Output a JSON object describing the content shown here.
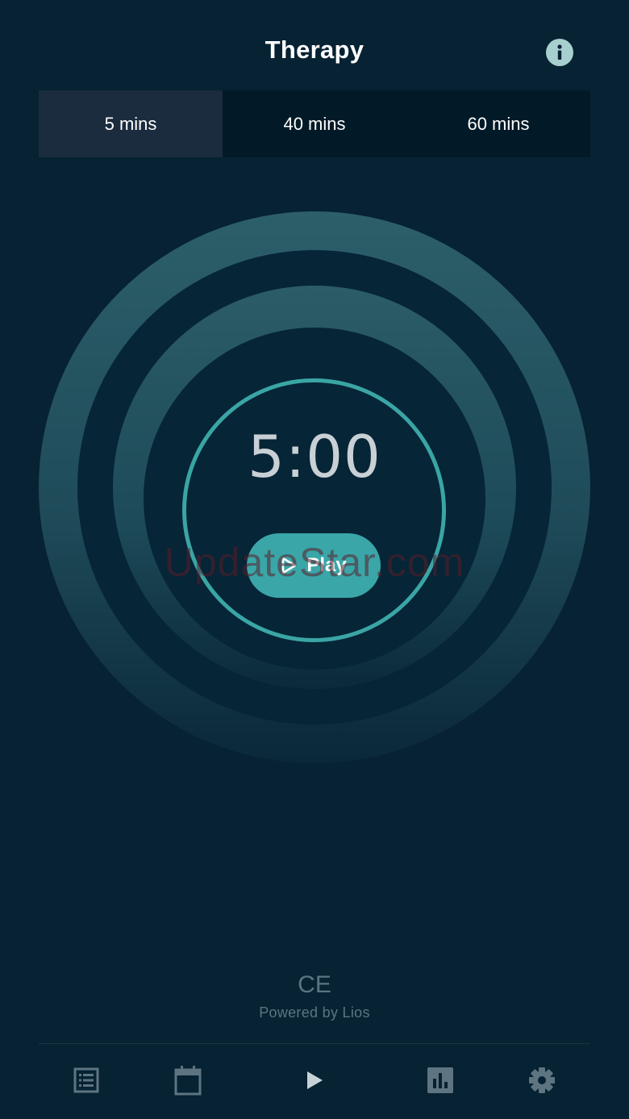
{
  "header": {
    "title": "Therapy",
    "info_icon": "info-icon"
  },
  "durations": {
    "options": [
      {
        "label": "5 mins",
        "active": true
      },
      {
        "label": "40 mins",
        "active": false
      },
      {
        "label": "60 mins",
        "active": false
      }
    ]
  },
  "timer": {
    "display": "5:00",
    "play_label": "Play",
    "play_icon": "play-icon"
  },
  "watermark": "UpdateStar.com",
  "footer": {
    "certification_mark": "CE",
    "powered_by": "Powered by Lios"
  },
  "nav": {
    "items": [
      {
        "name": "list",
        "icon": "list-icon",
        "active": false
      },
      {
        "name": "calendar",
        "icon": "calendar-icon",
        "active": false
      },
      {
        "name": "play",
        "icon": "play-icon",
        "active": true
      },
      {
        "name": "stats",
        "icon": "bar-chart-icon",
        "active": false
      },
      {
        "name": "settings",
        "icon": "gear-icon",
        "active": false
      }
    ]
  },
  "colors": {
    "background": "#062233",
    "accent": "#3aa6a8",
    "segment_active": "#1a2c3e",
    "segment_bar": "#021a27",
    "ring": "#2c5e69",
    "muted_text": "#5e7480"
  }
}
